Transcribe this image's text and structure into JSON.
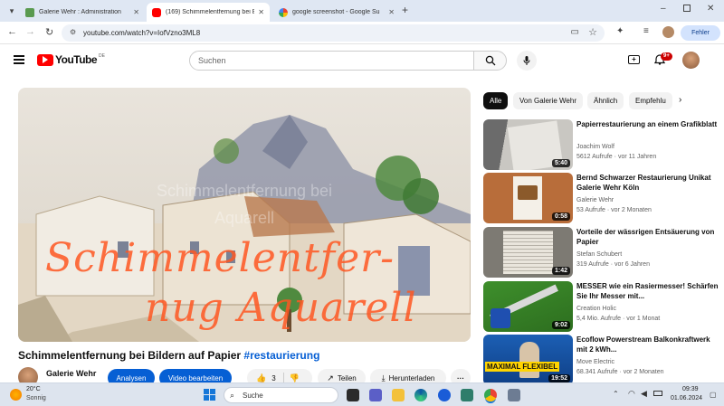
{
  "browser": {
    "tabs": [
      {
        "title": "Galerie Wehr : Administration",
        "icon": "galerie-icon",
        "active": false
      },
      {
        "title": "(169) Schimmelentfernung bei B",
        "icon": "youtube-icon",
        "active": true
      },
      {
        "title": "google screenshot - Google Su",
        "icon": "google-icon",
        "active": false
      }
    ],
    "url": "youtube.com/watch?v=IofVzno3ML8",
    "error_button": "Fehler"
  },
  "youtube": {
    "logo_text": "YouTube",
    "country_code": "DE",
    "search_placeholder": "Suchen",
    "notification_count": "9+"
  },
  "video": {
    "overlay_text_line1": "Schimmelentfer-",
    "overlay_text_line2": "nug Aquarell",
    "title": "Schimmelentfernung bei Bildern auf Papier",
    "hashtag": "#restaurierung",
    "channel": "Galerie Wehr",
    "analytics_button": "Analysen",
    "edit_button": "Video bearbeiten",
    "likes": "3",
    "share_button": "Teilen",
    "download_button": "Herunterladen"
  },
  "chips": [
    "Alle",
    "Von Galerie Wehr",
    "Ähnlich",
    "Empfehlu"
  ],
  "recommendations": [
    {
      "title": "Papierrestaurierung an einem Grafikblatt",
      "channel": "Joachim Wolf",
      "views": "5612 Aufrufe",
      "age": "vor 11 Jahren",
      "duration": "5:40"
    },
    {
      "title": "Bernd Schwarzer Restaurierung Unikat Galerie Wehr Köln",
      "channel": "Galerie Wehr",
      "views": "53 Aufrufe",
      "age": "vor 2 Monaten",
      "duration": "0:58"
    },
    {
      "title": "Vorteile der wässrigen Entsäuerung von Papier",
      "channel": "Stefan Schubert",
      "views": "319 Aufrufe",
      "age": "vor 6 Jahren",
      "duration": "1:42"
    },
    {
      "title": "MESSER wie ein Rasiermesser! Schärfen Sie Ihr Messer mit...",
      "channel": "Creation Holic",
      "views": "5,4 Mio. Aufrufe",
      "age": "vor 1 Monat",
      "duration": "9:02"
    },
    {
      "title": "Ecoflow Powerstream Balkonkraftwerk mit 2 kWh...",
      "channel": "Move Electric",
      "views": "68.341 Aufrufe",
      "age": "vor 2 Monaten",
      "duration": "19:52",
      "thumb_text": "MAXIMAL FLEXIBEL"
    }
  ],
  "taskbar": {
    "temperature": "20°C",
    "weather": "Sonnig",
    "search_label": "Suche",
    "time": "09:39",
    "date": "01.06.2024"
  }
}
